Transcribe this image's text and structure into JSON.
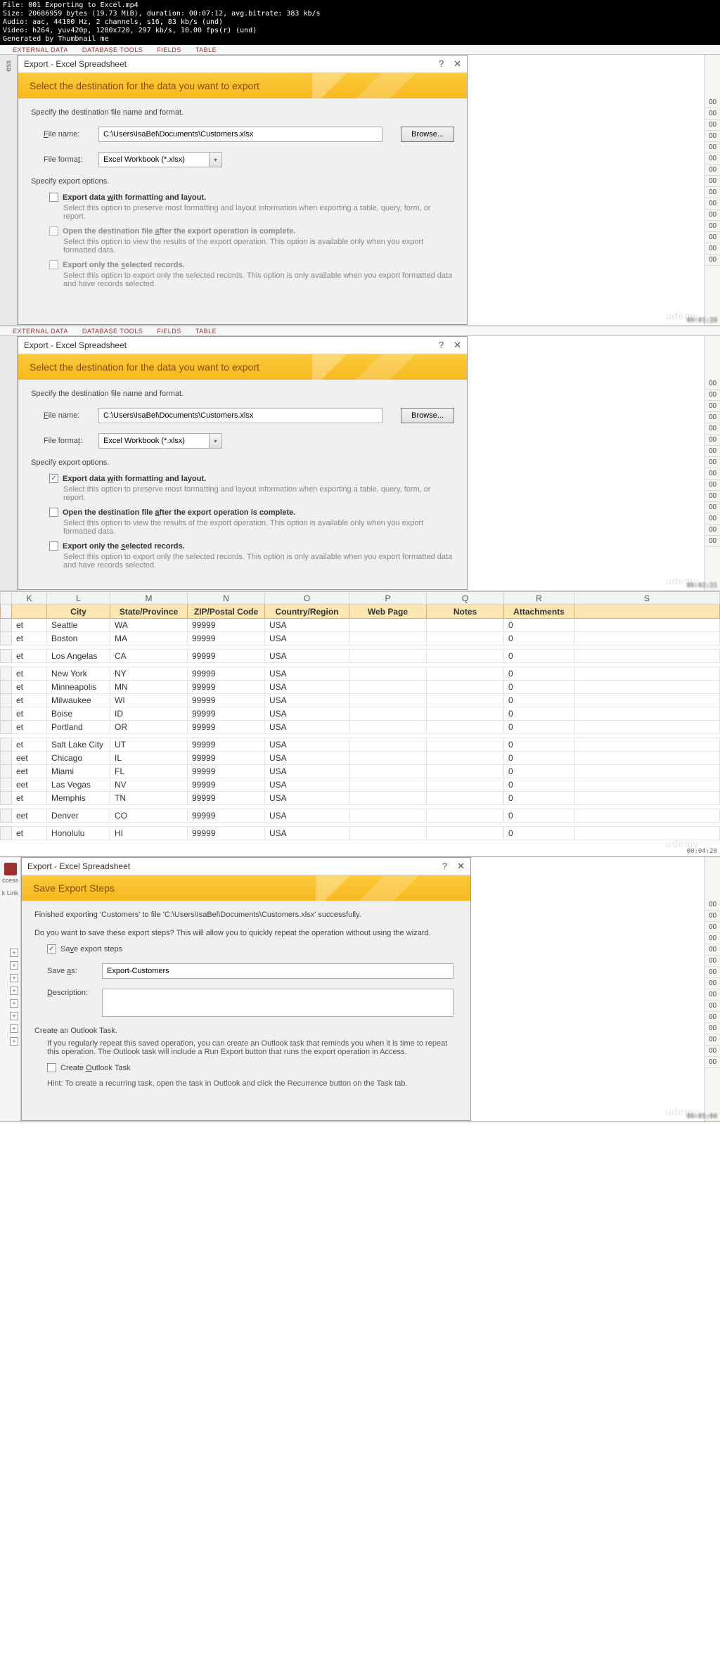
{
  "meta_header": "File: 001 Exporting to Excel.mp4\nSize: 20686959 bytes (19.73 MiB), duration: 00:07:12, avg.bitrate: 383 kb/s\nAudio: aac, 44100 Hz, 2 channels, s16, 83 kb/s (und)\nVideo: h264, yuv420p, 1280x720, 297 kb/s, 10.00 fps(r) (und)\nGenerated by Thumbnail me",
  "ribbon": {
    "t1": "EXTERNAL DATA",
    "t2": "DATABASE TOOLS",
    "t3": "FIELDS",
    "t4": "TABLE"
  },
  "sidebar": {
    "ess": "ess",
    "link": "Link"
  },
  "right_repeat": "00",
  "dlg": {
    "title": "Export - Excel Spreadsheet",
    "banner": "Select the destination for the data you want to export",
    "specify": "Specify the destination file name and format.",
    "fname_label": "File name:",
    "fname_value": "C:\\Users\\IsaBel\\Documents\\Customers.xlsx",
    "browse": "Browse...",
    "fformat_label": "File format:",
    "fformat_value": "Excel Workbook (*.xlsx)",
    "opts_label": "Specify export options.",
    "o1_t": "Export data with formatting and layout.",
    "o1_d": "Select this option to preserve most formatting and layout information when exporting a table, query, form, or report.",
    "o2_t": "Open the destination file after the export operation is complete.",
    "o2_d": "Select this option to view the results of the export operation. This option is available only when you export formatted data.",
    "o3_t": "Export only the selected records.",
    "o3_d": "Select this option to export only the selected records. This option is only available when you export formatted data and have records selected."
  },
  "ts1": "00:01:28",
  "ts2": "00:02:31",
  "ts3": "00:04:20",
  "ts4": "00:05:04",
  "sheet": {
    "cols": [
      "K",
      "L",
      "M",
      "N",
      "O",
      "P",
      "Q",
      "R",
      "S"
    ],
    "headers": [
      "",
      "City",
      "State/Province",
      "ZIP/Postal Code",
      "Country/Region",
      "Web Page",
      "Notes",
      "Attachments",
      ""
    ],
    "rows": [
      [
        "et",
        "Seattle",
        "WA",
        "99999",
        "USA",
        "",
        "",
        "0",
        ""
      ],
      [
        "et",
        "Boston",
        "MA",
        "99999",
        "USA",
        "",
        "",
        "0",
        ""
      ],
      [
        "et",
        "Los Angelas",
        "CA",
        "99999",
        "USA",
        "",
        "",
        "0",
        ""
      ],
      [
        "et",
        "New York",
        "NY",
        "99999",
        "USA",
        "",
        "",
        "0",
        ""
      ],
      [
        "et",
        "Minneapolis",
        "MN",
        "99999",
        "USA",
        "",
        "",
        "0",
        ""
      ],
      [
        "et",
        "Milwaukee",
        "WI",
        "99999",
        "USA",
        "",
        "",
        "0",
        ""
      ],
      [
        "et",
        "Boise",
        "ID",
        "99999",
        "USA",
        "",
        "",
        "0",
        ""
      ],
      [
        "et",
        "Portland",
        "OR",
        "99999",
        "USA",
        "",
        "",
        "0",
        ""
      ],
      [
        "et",
        "Salt Lake City",
        "UT",
        "99999",
        "USA",
        "",
        "",
        "0",
        ""
      ],
      [
        "eet",
        "Chicago",
        "IL",
        "99999",
        "USA",
        "",
        "",
        "0",
        ""
      ],
      [
        "eet",
        "Miami",
        "FL",
        "99999",
        "USA",
        "",
        "",
        "0",
        ""
      ],
      [
        "eet",
        "Las Vegas",
        "NV",
        "99999",
        "USA",
        "",
        "",
        "0",
        ""
      ],
      [
        "et",
        "Memphis",
        "TN",
        "99999",
        "USA",
        "",
        "",
        "0",
        ""
      ],
      [
        "eet",
        "Denver",
        "CO",
        "99999",
        "USA",
        "",
        "",
        "0",
        ""
      ],
      [
        "et",
        "Honolulu",
        "HI",
        "99999",
        "USA",
        "",
        "",
        "0",
        ""
      ]
    ]
  },
  "dlg3": {
    "title": "Export - Excel Spreadsheet",
    "banner": "Save Export Steps",
    "finished": "Finished exporting 'Customers' to file 'C:\\Users\\IsaBel\\Documents\\Customers.xlsx' successfully.",
    "prompt": "Do you want to save these export steps? This will allow you to quickly repeat the operation without using the wizard.",
    "save_cb": "Save export steps",
    "saveas_label": "Save as:",
    "saveas_value": "Export-Customers",
    "desc_label": "Description:",
    "outlook_hdr": "Create an Outlook Task.",
    "outlook_desc": "If you regularly repeat this saved operation, you can create an Outlook task that reminds you when it is time to repeat this operation. The Outlook task will include a Run Export button that runs the export operation in Access.",
    "outlook_cb": "Create Outlook Task",
    "outlook_hint": "Hint: To create a recurring task, open the task in Outlook and click the Recurrence button on the Task tab."
  },
  "access_label": "ccess",
  "link_label": "k Link"
}
